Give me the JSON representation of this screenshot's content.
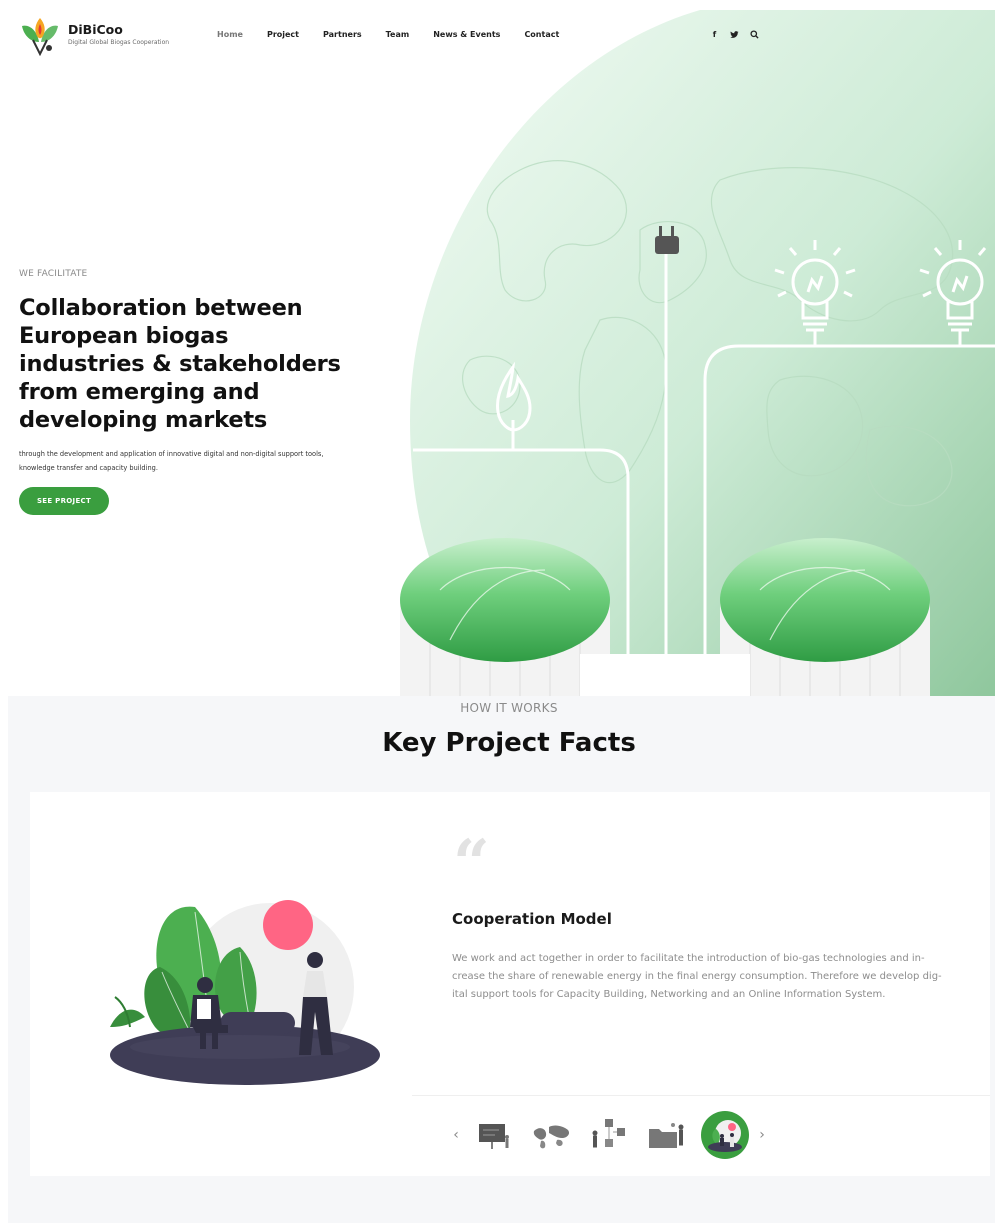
{
  "site": {
    "name": "DiBiCoo",
    "tagline": "Digital Global Biogas Cooperation"
  },
  "nav": {
    "items": [
      {
        "label": "Home",
        "active": true
      },
      {
        "label": "Project",
        "active": false
      },
      {
        "label": "Partners",
        "active": false
      },
      {
        "label": "Team",
        "active": false
      },
      {
        "label": "News & Events",
        "active": false
      },
      {
        "label": "Contact",
        "active": false
      }
    ]
  },
  "social": {
    "facebook_icon": "f",
    "twitter_icon": "t",
    "search_icon": "search"
  },
  "hero": {
    "eyebrow": "WE FACILITATE",
    "title": "Collaboration between European biogas industries & stakeholders from emerging and developing markets",
    "subtitle": "through the development and application of innovative digital and non-digital support tools, knowledge transfer and capacity building.",
    "cta_label": "SEE PROJECT"
  },
  "facts": {
    "eyebrow": "HOW IT WORKS",
    "title": "Key Project Facts",
    "card": {
      "quote_mark": "“",
      "title": "Cooperation Model",
      "body": "We work and act together in order to facilitate the introduction of bio-gas technologies and in-crease the share of renewable energy in the final energy consumption. Therefore we develop dig-ital support tools for Capacity Building, Networking and an Online Information System."
    },
    "carousel": {
      "prev_label": "‹",
      "next_label": "›",
      "active_index": 4,
      "thumbs": [
        "presentation-board",
        "world-map",
        "mind-map",
        "folder-people",
        "cooperation-people"
      ]
    }
  },
  "colors": {
    "brand_green": "#3a9e3f",
    "hero_bg_green": "#c5e8cf",
    "accent_pink": "#ff6584",
    "dark_figure": "#3f3d56"
  }
}
